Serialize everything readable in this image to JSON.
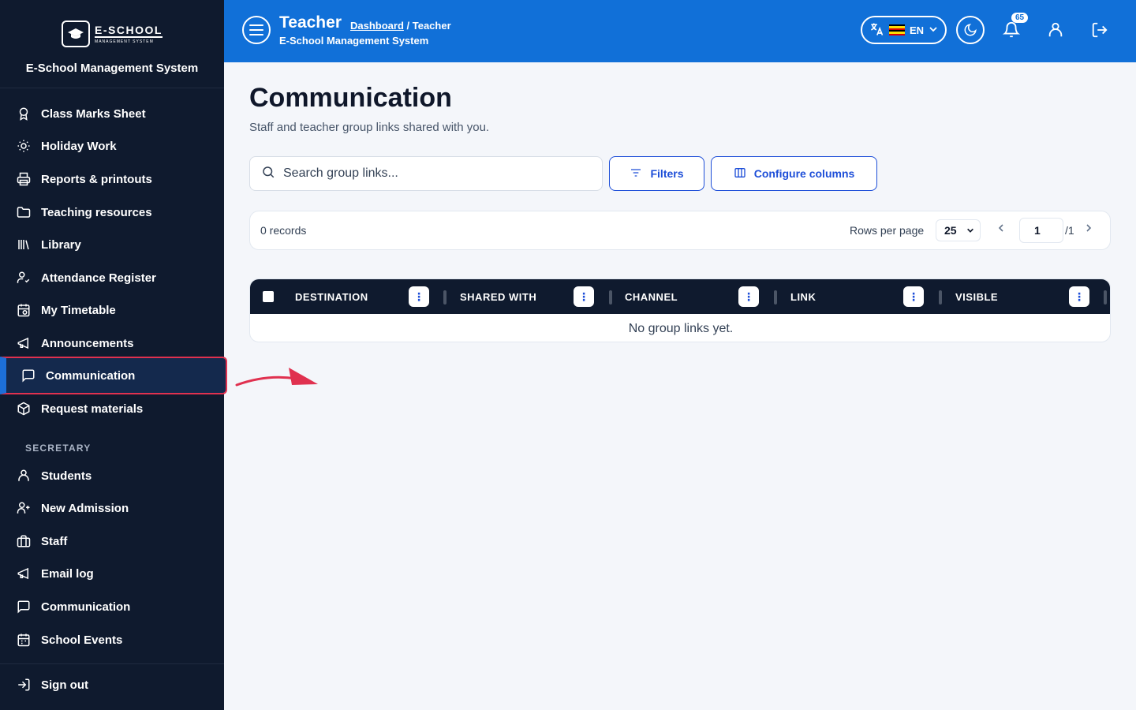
{
  "sidebar": {
    "logo_main": "E-SCHOOL",
    "logo_sub": "MANAGEMENT SYSTEM",
    "brand_title": "E-School Management System",
    "items": [
      {
        "label": "Class Marks Sheet",
        "icon": "award-icon"
      },
      {
        "label": "Holiday Work",
        "icon": "sun-icon"
      },
      {
        "label": "Reports & printouts",
        "icon": "printer-icon"
      },
      {
        "label": "Teaching resources",
        "icon": "folder-icon"
      },
      {
        "label": "Library",
        "icon": "library-icon"
      },
      {
        "label": "Attendance Register",
        "icon": "user-check-icon"
      },
      {
        "label": "My Timetable",
        "icon": "calendar-clock-icon"
      },
      {
        "label": "Announcements",
        "icon": "megaphone-icon"
      },
      {
        "label": "Communication",
        "icon": "message-square-icon",
        "active": true
      },
      {
        "label": "Request materials",
        "icon": "package-icon"
      }
    ],
    "section_secretary": "SECRETARY",
    "secretary_items": [
      {
        "label": "Students",
        "icon": "user-icon"
      },
      {
        "label": "New Admission",
        "icon": "user-plus-icon"
      },
      {
        "label": "Staff",
        "icon": "briefcase-icon"
      },
      {
        "label": "Email log",
        "icon": "megaphone-icon"
      },
      {
        "label": "Communication",
        "icon": "message-square-icon"
      },
      {
        "label": "School Events",
        "icon": "calendar-icon"
      }
    ],
    "sign_out": "Sign out"
  },
  "topbar": {
    "title": "Teacher",
    "breadcrumb_link": "Dashboard",
    "breadcrumb_current": " / Teacher",
    "subtitle": "E-School Management System",
    "language": "EN",
    "notification_count": "65"
  },
  "main": {
    "title": "Communication",
    "description": "Staff and teacher group links shared with you.",
    "search_placeholder": "Search group links...",
    "filters_label": "Filters",
    "configure_label": "Configure columns",
    "records": "0 records",
    "rows_per_page_label": "Rows per page",
    "rows_per_page": "25",
    "page": "1",
    "page_total": "/1",
    "columns": [
      "DESTINATION",
      "SHARED WITH",
      "CHANNEL",
      "LINK",
      "VISIBLE"
    ],
    "empty_message": "No group links yet."
  },
  "colors": {
    "sidebar_bg": "#0f1a2e",
    "topbar_bg": "#1170d8",
    "accent": "#1d4ed8",
    "highlight": "#e0314f"
  }
}
